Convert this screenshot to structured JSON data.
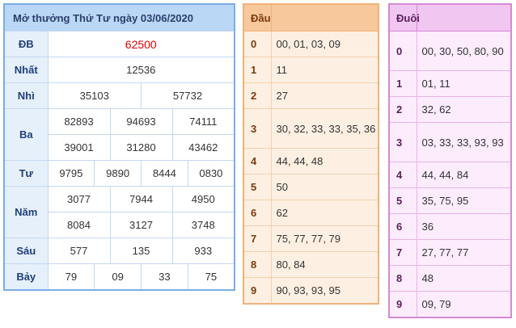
{
  "results": {
    "title": "Mở thưởng Thứ Tư ngày 03/06/2020",
    "rows": {
      "db": {
        "label": "ĐB",
        "values": [
          "62500"
        ]
      },
      "nhat": {
        "label": "Nhất",
        "values": [
          "12536"
        ]
      },
      "nhi": {
        "label": "Nhì",
        "values": [
          "35103",
          "57732"
        ]
      },
      "ba": {
        "label": "Ba",
        "values": [
          "82893",
          "94693",
          "74111",
          "39001",
          "31280",
          "43462"
        ]
      },
      "tu": {
        "label": "Tư",
        "values": [
          "9795",
          "9890",
          "8444",
          "0830"
        ]
      },
      "nam": {
        "label": "Năm",
        "values": [
          "3077",
          "7944",
          "4950",
          "8084",
          "3127",
          "3748"
        ]
      },
      "sau": {
        "label": "Sáu",
        "values": [
          "577",
          "135",
          "933"
        ]
      },
      "bay": {
        "label": "Bảy",
        "values": [
          "79",
          "09",
          "33",
          "75"
        ]
      }
    },
    "special_color": "#e00000"
  },
  "dau": {
    "title": "Đầu",
    "rows": [
      {
        "key": "0",
        "value": "00, 01, 03, 09"
      },
      {
        "key": "1",
        "value": "11"
      },
      {
        "key": "2",
        "value": "27"
      },
      {
        "key": "3",
        "value": "30, 32, 33, 33, 35, 36"
      },
      {
        "key": "4",
        "value": "44, 44, 48"
      },
      {
        "key": "5",
        "value": "50"
      },
      {
        "key": "6",
        "value": "62"
      },
      {
        "key": "7",
        "value": "75, 77, 77, 79"
      },
      {
        "key": "8",
        "value": "80, 84"
      },
      {
        "key": "9",
        "value": "90, 93, 93, 95"
      }
    ]
  },
  "duoi": {
    "title": "Đuôi",
    "rows": [
      {
        "key": "0",
        "value": "00, 30, 50, 80, 90"
      },
      {
        "key": "1",
        "value": "01, 11"
      },
      {
        "key": "2",
        "value": "32, 62"
      },
      {
        "key": "3",
        "value": "03, 33, 33, 93, 93"
      },
      {
        "key": "4",
        "value": "44, 44, 84"
      },
      {
        "key": "5",
        "value": "35, 75, 95"
      },
      {
        "key": "6",
        "value": "36"
      },
      {
        "key": "7",
        "value": "27, 77, 77"
      },
      {
        "key": "8",
        "value": "48"
      },
      {
        "key": "9",
        "value": "09, 79"
      }
    ]
  }
}
